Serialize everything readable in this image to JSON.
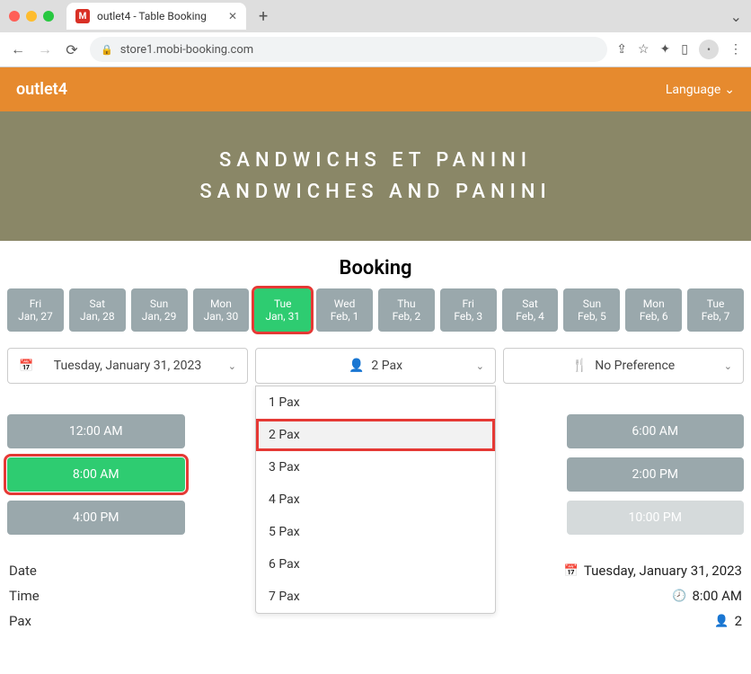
{
  "browser": {
    "tab_title": "outlet4 - Table Booking",
    "url": "store1.mobi-booking.com"
  },
  "header": {
    "brand": "outlet4",
    "language_label": "Language"
  },
  "hero": {
    "line1": "SANDWICHS ET PANINI",
    "line2": "SANDWICHES AND PANINI"
  },
  "section_title": "Booking",
  "dates": [
    {
      "dow": "Fri",
      "md": "Jan, 27",
      "selected": false
    },
    {
      "dow": "Sat",
      "md": "Jan, 28",
      "selected": false
    },
    {
      "dow": "Sun",
      "md": "Jan, 29",
      "selected": false
    },
    {
      "dow": "Mon",
      "md": "Jan, 30",
      "selected": false
    },
    {
      "dow": "Tue",
      "md": "Jan, 31",
      "selected": true
    },
    {
      "dow": "Wed",
      "md": "Feb, 1",
      "selected": false
    },
    {
      "dow": "Thu",
      "md": "Feb, 2",
      "selected": false
    },
    {
      "dow": "Fri",
      "md": "Feb, 3",
      "selected": false
    },
    {
      "dow": "Sat",
      "md": "Feb, 4",
      "selected": false
    },
    {
      "dow": "Sun",
      "md": "Feb, 5",
      "selected": false
    },
    {
      "dow": "Mon",
      "md": "Feb, 6",
      "selected": false
    },
    {
      "dow": "Tue",
      "md": "Feb, 7",
      "selected": false
    }
  ],
  "selectors": {
    "date_value": "Tuesday, January 31, 2023",
    "pax_value": "2 Pax",
    "pref_value": "No Preference"
  },
  "pax_options": [
    "1 Pax",
    "2 Pax",
    "3 Pax",
    "4 Pax",
    "5 Pax",
    "6 Pax",
    "7 Pax"
  ],
  "pax_selected_index": 1,
  "slots": [
    {
      "t": "12:00 AM",
      "state": "normal"
    },
    {
      "t": "",
      "state": "hidden"
    },
    {
      "t": "",
      "state": "hidden"
    },
    {
      "t": "6:00 AM",
      "state": "normal"
    },
    {
      "t": "8:00 AM",
      "state": "selected"
    },
    {
      "t": "",
      "state": "hidden"
    },
    {
      "t": "",
      "state": "hidden"
    },
    {
      "t": "2:00 PM",
      "state": "normal"
    },
    {
      "t": "4:00 PM",
      "state": "normal"
    },
    {
      "t": "",
      "state": "hidden"
    },
    {
      "t": "",
      "state": "hidden"
    },
    {
      "t": "10:00 PM",
      "state": "disabled"
    }
  ],
  "summary": {
    "date_label": "Date",
    "date_value": "Tuesday, January 31, 2023",
    "time_label": "Time",
    "time_value": "8:00 AM",
    "pax_label": "Pax",
    "pax_value": "2"
  }
}
